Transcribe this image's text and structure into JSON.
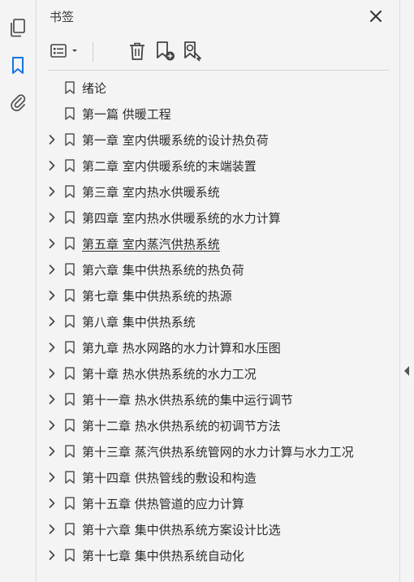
{
  "rail": {
    "icons": [
      "pages-icon",
      "bookmark-icon",
      "attachment-icon"
    ],
    "active_color": "#1473e6"
  },
  "panel": {
    "title": "书签"
  },
  "bookmarks": [
    {
      "label": "绪论",
      "expandable": false
    },
    {
      "label": "第一篇  供暖工程",
      "expandable": false
    },
    {
      "label": "第一章  室内供暖系统的设计热负荷",
      "expandable": true
    },
    {
      "label": "第二章  室内供暖系统的末端装置",
      "expandable": true
    },
    {
      "label": "第三章  室内热水供暖系统",
      "expandable": true
    },
    {
      "label": "第四章  室内热水供暖系统的水力计算",
      "expandable": true
    },
    {
      "label": "第五章  室内蒸汽供热系统",
      "expandable": true,
      "underlined": true
    },
    {
      "label": "第六章  集中供热系统的热负荷",
      "expandable": true
    },
    {
      "label": "第七章  集中供热系统的热源",
      "expandable": true
    },
    {
      "label": "第八章  集中供热系统",
      "expandable": true
    },
    {
      "label": "第九章  热水网路的水力计算和水压图",
      "expandable": true
    },
    {
      "label": "第十章  热水供热系统的水力工况",
      "expandable": true
    },
    {
      "label": "第十一章  热水供热系统的集中运行调节",
      "expandable": true
    },
    {
      "label": "第十二章  热水供热系统的初调节方法",
      "expandable": true
    },
    {
      "label": "第十三章  蒸汽供热系统管网的水力计算与水力工况",
      "expandable": true
    },
    {
      "label": "第十四章  供热管线的敷设和构造",
      "expandable": true
    },
    {
      "label": "第十五章  供热管道的应力计算",
      "expandable": true
    },
    {
      "label": "第十六章  集中供热系统方案设计比选",
      "expandable": true
    },
    {
      "label": "第十七章  集中供热系统自动化",
      "expandable": true
    }
  ]
}
